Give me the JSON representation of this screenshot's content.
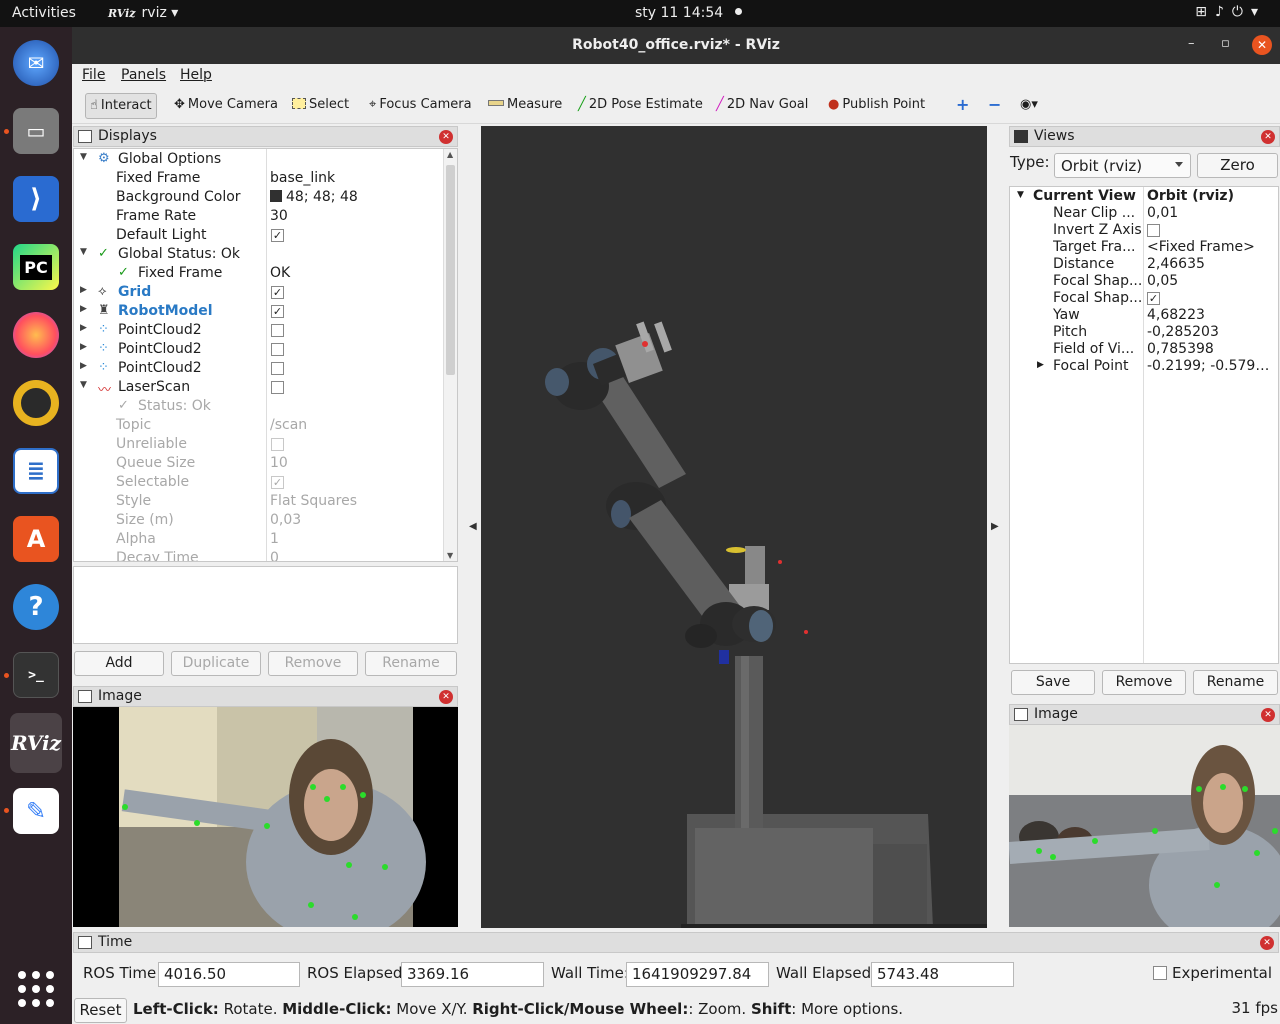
{
  "topbar": {
    "activities": "Activities",
    "app_name": "rviz",
    "app_logo": "RViz",
    "clock": "sty 11  14:54",
    "tray_icons": [
      "network-icon",
      "volume-icon",
      "power-icon",
      "chevron-down-icon"
    ]
  },
  "dock": {
    "items": [
      {
        "name": "thunderbird",
        "icon": "mail-icon",
        "color": "#3a7bd5"
      },
      {
        "name": "files",
        "icon": "folder-icon",
        "color": "#6b6b6b"
      },
      {
        "name": "vscode",
        "icon": "vscode-icon",
        "color": "#2a6bd1"
      },
      {
        "name": "pycharm",
        "icon": "pycharm-icon",
        "label": "PC",
        "color": "#22c55e"
      },
      {
        "name": "firefox",
        "icon": "firefox-icon",
        "color": "#ff7139"
      },
      {
        "name": "rhythmbox",
        "icon": "speaker-icon",
        "color": "#e8b320"
      },
      {
        "name": "writer",
        "icon": "document-icon",
        "color": "#2f6fc9"
      },
      {
        "name": "software",
        "icon": "store-icon",
        "color": "#e95420"
      },
      {
        "name": "help",
        "icon": "help-icon",
        "label": "?",
        "color": "#2e86d9"
      },
      {
        "name": "terminal",
        "icon": "terminal-icon",
        "label": ">_",
        "color": "#3a3a3a"
      },
      {
        "name": "rviz",
        "icon": "rviz-icon",
        "label": "RViz",
        "color": "#444444"
      },
      {
        "name": "text-editor",
        "icon": "text-editor-icon",
        "color": "#3b82f6"
      }
    ]
  },
  "window": {
    "title": "Robot40_office.rviz* - RViz",
    "menu": [
      "File",
      "Panels",
      "Help"
    ],
    "toolbar": [
      {
        "label": "Interact",
        "icon": "cursor-icon"
      },
      {
        "label": "Move Camera",
        "icon": "move-camera-icon"
      },
      {
        "label": "Select",
        "icon": "select-icon"
      },
      {
        "label": "Focus Camera",
        "icon": "focus-camera-icon"
      },
      {
        "label": "Measure",
        "icon": "ruler-icon"
      },
      {
        "label": "2D Pose Estimate",
        "icon": "pose-estimate-icon"
      },
      {
        "label": "2D Nav Goal",
        "icon": "nav-goal-icon"
      },
      {
        "label": "Publish Point",
        "icon": "map-pin-icon"
      }
    ]
  },
  "displays": {
    "title": "Displays",
    "rows": [
      {
        "label": "Global Options"
      },
      {
        "label": "Fixed Frame",
        "value": "base_link"
      },
      {
        "label": "Background Color",
        "value": "48; 48; 48",
        "swatch": "#303030"
      },
      {
        "label": "Frame Rate",
        "value": "30"
      },
      {
        "label": "Default Light",
        "check": "✓"
      },
      {
        "label": "Global Status: Ok"
      },
      {
        "label": "Fixed Frame",
        "value": "OK"
      },
      {
        "label": "Grid",
        "check": "✓"
      },
      {
        "label": "RobotModel",
        "check": "✓"
      },
      {
        "label": "PointCloud2",
        "check": ""
      },
      {
        "label": "PointCloud2",
        "check": ""
      },
      {
        "label": "PointCloud2",
        "check": ""
      },
      {
        "label": "LaserScan",
        "check": ""
      },
      {
        "label": "Status: Ok"
      },
      {
        "label": "Topic",
        "value": "/scan"
      },
      {
        "label": "Unreliable",
        "check": ""
      },
      {
        "label": "Queue Size",
        "value": "10"
      },
      {
        "label": "Selectable",
        "check": "✓"
      },
      {
        "label": "Style",
        "value": "Flat Squares"
      },
      {
        "label": "Size (m)",
        "value": "0,03"
      },
      {
        "label": "Alpha",
        "value": "1"
      },
      {
        "label": "Decay Time",
        "value": "0"
      }
    ],
    "buttons": {
      "add": "Add",
      "duplicate": "Duplicate",
      "remove": "Remove",
      "rename": "Rename"
    }
  },
  "views": {
    "title": "Views",
    "type_label": "Type:",
    "type_value": "Orbit (rviz)",
    "zero": "Zero",
    "current_view": {
      "label": "Current View",
      "value": "Orbit (rviz)"
    },
    "props": [
      {
        "label": "Near Clip ...",
        "value": "0,01"
      },
      {
        "label": "Invert Z Axis",
        "check": ""
      },
      {
        "label": "Target Fra...",
        "value": "<Fixed Frame>"
      },
      {
        "label": "Distance",
        "value": "2,46635"
      },
      {
        "label": "Focal Shap...",
        "value": "0,05"
      },
      {
        "label": "Focal Shap...",
        "check": "✓"
      },
      {
        "label": "Yaw",
        "value": "4,68223"
      },
      {
        "label": "Pitch",
        "value": "-0,285203"
      },
      {
        "label": "Field of Vi...",
        "value": "0,785398"
      },
      {
        "label": "Focal Point",
        "value": "-0.2199; -0.5794..."
      }
    ],
    "buttons": {
      "save": "Save",
      "remove": "Remove",
      "rename": "Rename"
    }
  },
  "image_left": {
    "title": "Image"
  },
  "image_right": {
    "title": "Image"
  },
  "time": {
    "title": "Time",
    "ros_time_label": "ROS Time:",
    "ros_time": "4016.50",
    "ros_elapsed_label": "ROS Elapsed:",
    "ros_elapsed": "3369.16",
    "wall_time_label": "Wall Time:",
    "wall_time": "1641909297.84",
    "wall_elapsed_label": "Wall Elapsed:",
    "wall_elapsed": "5743.48",
    "experimental": "Experimental"
  },
  "status": {
    "reset": "Reset",
    "k1": "Left-Click:",
    "t1": " Rotate. ",
    "k2": "Middle-Click:",
    "t2": " Move X/Y. ",
    "k3": "Right-Click/Mouse Wheel:",
    "t3": ": Zoom. ",
    "k4": "Shift",
    "t4": ": More options.",
    "fps": "31 fps"
  }
}
